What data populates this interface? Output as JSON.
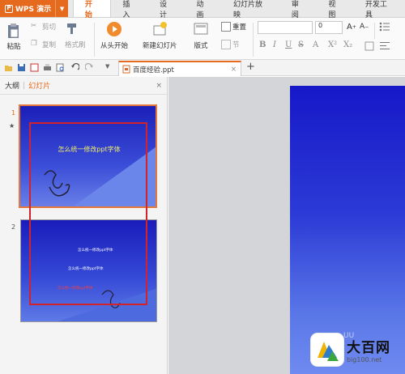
{
  "app": {
    "name": "WPS 演示"
  },
  "menu_tabs": [
    "开始",
    "插入",
    "设计",
    "动画",
    "幻灯片放映",
    "审阅",
    "视图",
    "开发工具"
  ],
  "ribbon": {
    "paste": "粘贴",
    "cut": "剪切",
    "copy": "复制",
    "format_painter": "格式刷",
    "from_start": "从头开始",
    "new_slide": "新建幻灯片",
    "layout": "版式",
    "reset": "重置",
    "section": "节",
    "font_size": "0",
    "format_buttons": [
      "B",
      "I",
      "U",
      "S",
      "A",
      "X²",
      "X₂"
    ]
  },
  "document": {
    "tab_title": "百度经验.ppt"
  },
  "panel": {
    "outline_tab": "大纲",
    "slides_tab": "幻灯片",
    "slide_numbers": [
      "1",
      "2"
    ]
  },
  "slide1": {
    "title": "怎么统一修改ppt字体"
  },
  "slide2": {
    "line1": "怎么统一修改ppt字体",
    "line2": "怎么统一修改ppt字体",
    "line3": "怎么统一修改ppt字体"
  },
  "watermark": {
    "title": "大百网",
    "url": "big100.net"
  },
  "colors": {
    "accent": "#e66a1e",
    "slide_blue": "#1b1fb8",
    "highlight_red": "#d2222a"
  }
}
